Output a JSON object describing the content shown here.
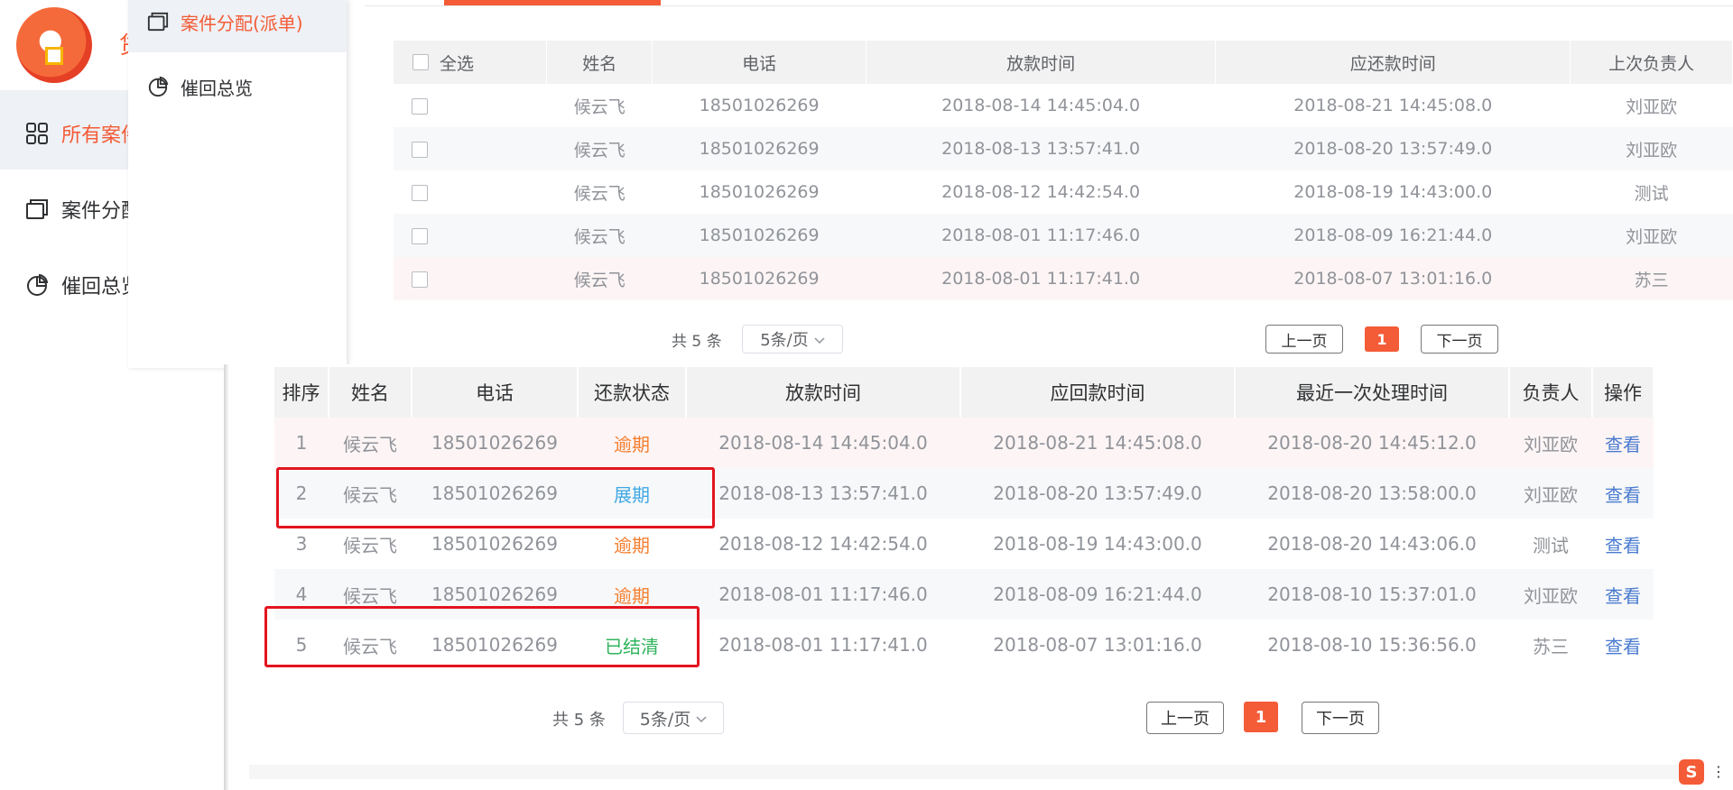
{
  "colors": {
    "accent": "#f45b37",
    "overdue": "#f57f30",
    "extended": "#3fa8e4",
    "paid": "#2fb35b",
    "link": "#4a7bd0",
    "highlight_box": "#e3141f"
  },
  "logo": {
    "text": "贷"
  },
  "sidebar": {
    "items": [
      {
        "label": "所有案件",
        "icon": "grid-icon"
      },
      {
        "label": "案件分配",
        "icon": "copy-icon"
      },
      {
        "label": "催回总览",
        "icon": "pie-chart-icon"
      }
    ]
  },
  "submenu": {
    "items": [
      {
        "label": "案件分配(派单)",
        "icon": "copy-icon"
      },
      {
        "label": "催回总览",
        "icon": "pie-chart-icon"
      }
    ]
  },
  "back_table": {
    "select_all_label": "全选",
    "columns": [
      "姓名",
      "电话",
      "放款时间",
      "应还款时间",
      "上次负责人"
    ],
    "rows": [
      {
        "name": "候云飞",
        "phone": "18501026269",
        "loan_time": "2018-08-14 14:45:04.0",
        "due_time": "2018-08-21 14:45:08.0",
        "last_owner": "刘亚欧"
      },
      {
        "name": "候云飞",
        "phone": "18501026269",
        "loan_time": "2018-08-13 13:57:41.0",
        "due_time": "2018-08-20 13:57:49.0",
        "last_owner": "刘亚欧"
      },
      {
        "name": "候云飞",
        "phone": "18501026269",
        "loan_time": "2018-08-12 14:42:54.0",
        "due_time": "2018-08-19 14:43:00.0",
        "last_owner": "测试"
      },
      {
        "name": "候云飞",
        "phone": "18501026269",
        "loan_time": "2018-08-01 11:17:46.0",
        "due_time": "2018-08-09 16:21:44.0",
        "last_owner": "刘亚欧"
      },
      {
        "name": "候云飞",
        "phone": "18501026269",
        "loan_time": "2018-08-01 11:17:41.0",
        "due_time": "2018-08-07 13:01:16.0",
        "last_owner": "苏三"
      }
    ],
    "pager": {
      "total": "共 5 条",
      "page_size": "5条/页",
      "prev": "上一页",
      "current": "1",
      "next": "下一页"
    }
  },
  "front_table": {
    "columns": [
      "排序",
      "姓名",
      "电话",
      "还款状态",
      "放款时间",
      "应回款时间",
      "最近一次处理时间",
      "负责人",
      "操作"
    ],
    "rows": [
      {
        "index": "1",
        "name": "候云飞",
        "phone": "18501026269",
        "status": "逾期",
        "status_kind": "overdue",
        "loan_time": "2018-08-14 14:45:04.0",
        "due_time": "2018-08-21 14:45:08.0",
        "last_handle": "2018-08-20 14:45:12.0",
        "owner": "刘亚欧",
        "action": "查看"
      },
      {
        "index": "2",
        "name": "候云飞",
        "phone": "18501026269",
        "status": "展期",
        "status_kind": "extended",
        "loan_time": "2018-08-13 13:57:41.0",
        "due_time": "2018-08-20 13:57:49.0",
        "last_handle": "2018-08-20 13:58:00.0",
        "owner": "刘亚欧",
        "action": "查看"
      },
      {
        "index": "3",
        "name": "候云飞",
        "phone": "18501026269",
        "status": "逾期",
        "status_kind": "overdue",
        "loan_time": "2018-08-12 14:42:54.0",
        "due_time": "2018-08-19 14:43:00.0",
        "last_handle": "2018-08-20 14:43:06.0",
        "owner": "测试",
        "action": "查看"
      },
      {
        "index": "4",
        "name": "候云飞",
        "phone": "18501026269",
        "status": "逾期",
        "status_kind": "overdue",
        "loan_time": "2018-08-01 11:17:46.0",
        "due_time": "2018-08-09 16:21:44.0",
        "last_handle": "2018-08-10 15:37:01.0",
        "owner": "刘亚欧",
        "action": "查看"
      },
      {
        "index": "5",
        "name": "候云飞",
        "phone": "18501026269",
        "status": "已结清",
        "status_kind": "paid",
        "loan_time": "2018-08-01 11:17:41.0",
        "due_time": "2018-08-07 13:01:16.0",
        "last_handle": "2018-08-10 15:36:56.0",
        "owner": "苏三",
        "action": "查看"
      }
    ],
    "pager": {
      "total": "共 5 条",
      "page_size": "5条/页",
      "prev": "上一页",
      "current": "1",
      "next": "下一页"
    }
  },
  "tray": {
    "ime_label": "S"
  }
}
